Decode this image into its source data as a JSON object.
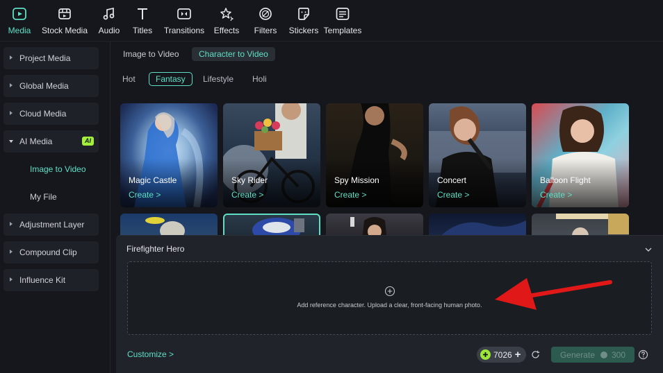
{
  "toolbar": {
    "items": [
      {
        "label": "Media",
        "icon": "media-icon",
        "active": true
      },
      {
        "label": "Stock Media",
        "icon": "stock-media-icon"
      },
      {
        "label": "Audio",
        "icon": "music-note-icon"
      },
      {
        "label": "Titles",
        "icon": "text-t-icon"
      },
      {
        "label": "Transitions",
        "icon": "transitions-icon"
      },
      {
        "label": "Effects",
        "icon": "sparkle-star-icon"
      },
      {
        "label": "Filters",
        "icon": "filters-icon"
      },
      {
        "label": "Stickers",
        "icon": "sticker-icon"
      },
      {
        "label": "Templates",
        "icon": "templates-icon"
      }
    ]
  },
  "sidebar": {
    "items": [
      {
        "label": "Project Media"
      },
      {
        "label": "Global Media"
      },
      {
        "label": "Cloud Media"
      },
      {
        "label": "AI Media",
        "badge": "AI",
        "expanded": true
      },
      {
        "label": "Image to Video",
        "sub": true,
        "active": true
      },
      {
        "label": "My File",
        "sub": true
      },
      {
        "label": "Adjustment Layer"
      },
      {
        "label": "Compound Clip"
      },
      {
        "label": "Influence Kit"
      }
    ]
  },
  "main": {
    "mode_tabs": [
      {
        "label": "Image to Video"
      },
      {
        "label": "Character to Video",
        "active": true
      }
    ],
    "category_tabs": [
      {
        "label": "Hot"
      },
      {
        "label": "Fantasy",
        "active": true
      },
      {
        "label": "Lifestyle"
      },
      {
        "label": "Holi"
      }
    ],
    "cards": [
      {
        "title": "Magic Castle",
        "action": "Create >"
      },
      {
        "title": "Sky Rider",
        "action": "Create >"
      },
      {
        "title": "Spy Mission",
        "action": "Create >"
      },
      {
        "title": "Concert",
        "action": "Create >"
      },
      {
        "title": "Balloon Flight",
        "action": "Create >"
      }
    ]
  },
  "panel": {
    "title": "Firefighter Hero",
    "upload_text": "Add reference character. Upload a clear, front-facing human photo.",
    "customize": "Customize >",
    "credits": "7026",
    "generate_label": "Generate",
    "generate_cost": "300"
  },
  "colors": {
    "accent": "#5fe0c4",
    "background": "#15171c",
    "panel": "#202329",
    "ai_badge": "#a4ef3a",
    "arrow": "#e01818"
  }
}
